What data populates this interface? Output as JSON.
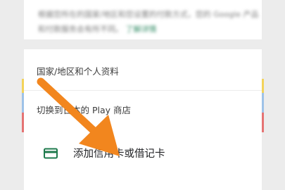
{
  "top_card": {
    "line1": "根据您所在的国家/地区和您设置的付款方式，您的 Google 产品",
    "line2": "和付款服务会有所不同。",
    "line2_link": "了解详情"
  },
  "menu": {
    "country_profile": "国家/地区和个人资料",
    "switch_store": "切换到日本的 Play 商店",
    "add_card": "添加信用卡或借记卡"
  },
  "colors": {
    "arrow": "#f2861e",
    "card_icon": "#1e7a4c",
    "side_red": "#e57373",
    "side_yellow": "#f3d35a",
    "side_blue": "#9ec2e8"
  },
  "icons": {
    "card": "credit-card-icon",
    "pointer": "arrow-pointer"
  }
}
